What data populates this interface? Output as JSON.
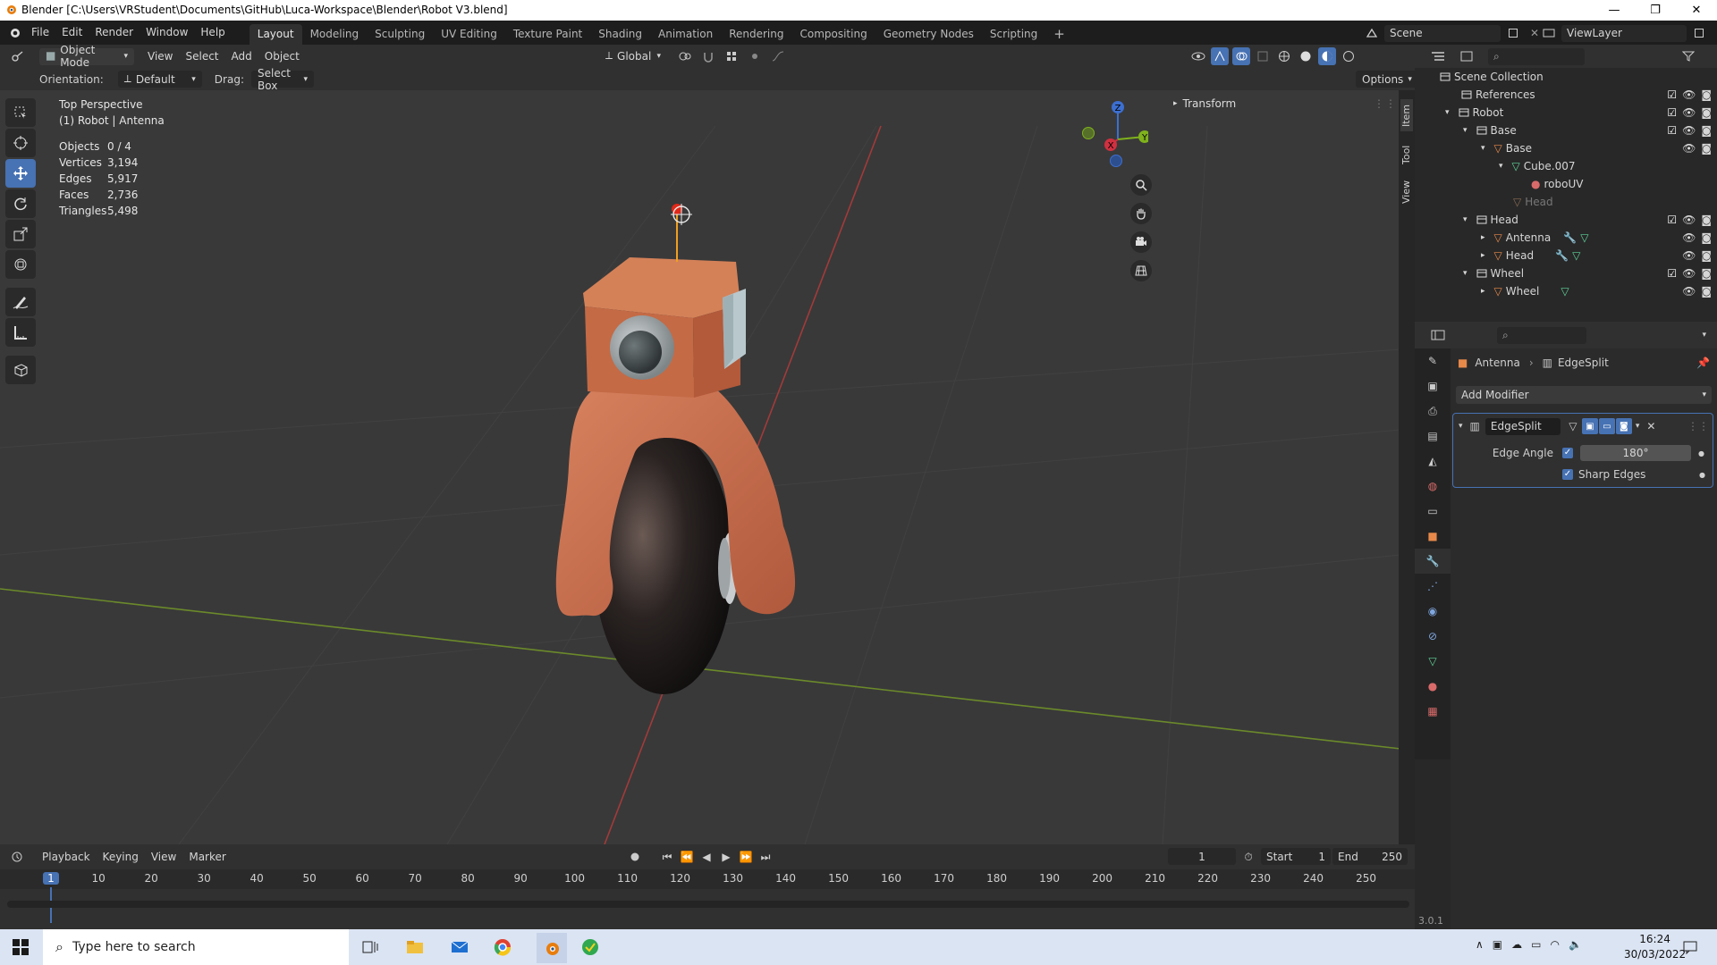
{
  "window": {
    "title": "Blender [C:\\Users\\VRStudent\\Documents\\GitHub\\Luca-Workspace\\Blender\\Robot V3.blend]"
  },
  "menus": [
    "File",
    "Edit",
    "Render",
    "Window",
    "Help"
  ],
  "workspaces": [
    "Layout",
    "Modeling",
    "Sculpting",
    "UV Editing",
    "Texture Paint",
    "Shading",
    "Animation",
    "Rendering",
    "Compositing",
    "Geometry Nodes",
    "Scripting"
  ],
  "scene": {
    "name": "Scene",
    "view_layer": "ViewLayer"
  },
  "viewport_header": {
    "mode": "Object Mode",
    "menus": [
      "View",
      "Select",
      "Add",
      "Object"
    ],
    "transform_orientation": "Global"
  },
  "tool_settings": {
    "orientation_label": "Orientation:",
    "orientation_value": "Default",
    "drag_label": "Drag:",
    "drag_value": "Select Box",
    "options": "Options"
  },
  "view_info": {
    "perspective": "Top Perspective",
    "object": "(1) Robot | Antenna"
  },
  "stats": [
    {
      "k": "Objects",
      "v": "0 / 4"
    },
    {
      "k": "Vertices",
      "v": "3,194"
    },
    {
      "k": "Edges",
      "v": "5,917"
    },
    {
      "k": "Faces",
      "v": "2,736"
    },
    {
      "k": "Triangles",
      "v": "5,498"
    }
  ],
  "npanel": {
    "section": "Transform",
    "tabs": [
      "Item",
      "Tool",
      "View"
    ]
  },
  "outliner": {
    "rows": [
      {
        "label": "Scene Collection"
      },
      {
        "label": "References"
      },
      {
        "label": "Robot"
      },
      {
        "label": "Base"
      },
      {
        "label": "Base"
      },
      {
        "label": "Cube.007"
      },
      {
        "label": "roboUV"
      },
      {
        "label": "Head"
      },
      {
        "label": "Head"
      },
      {
        "label": "Antenna"
      },
      {
        "label": "Head"
      },
      {
        "label": "Wheel"
      },
      {
        "label": "Wheel"
      }
    ]
  },
  "properties": {
    "breadcrumb_object": "Antenna",
    "breadcrumb_modifier": "EdgeSplit",
    "add_modifier": "Add Modifier",
    "modifier_name": "EdgeSplit",
    "edge_angle_label": "Edge Angle",
    "edge_angle_value": "180°",
    "sharp_edges_label": "Sharp Edges"
  },
  "timeline": {
    "menus": [
      "Playback",
      "Keying",
      "View",
      "Marker"
    ],
    "current_frame": "1",
    "start_label": "Start",
    "start": "1",
    "end_label": "End",
    "end": "250",
    "ticks": [
      "1",
      "10",
      "20",
      "30",
      "40",
      "50",
      "60",
      "70",
      "80",
      "90",
      "100",
      "110",
      "120",
      "130",
      "140",
      "150",
      "160",
      "170",
      "180",
      "190",
      "200",
      "210",
      "220",
      "230",
      "240",
      "250"
    ]
  },
  "version": "3.0.1",
  "taskbar": {
    "search_placeholder": "Type here to search",
    "time": "16:24",
    "date": "30/03/2022"
  }
}
